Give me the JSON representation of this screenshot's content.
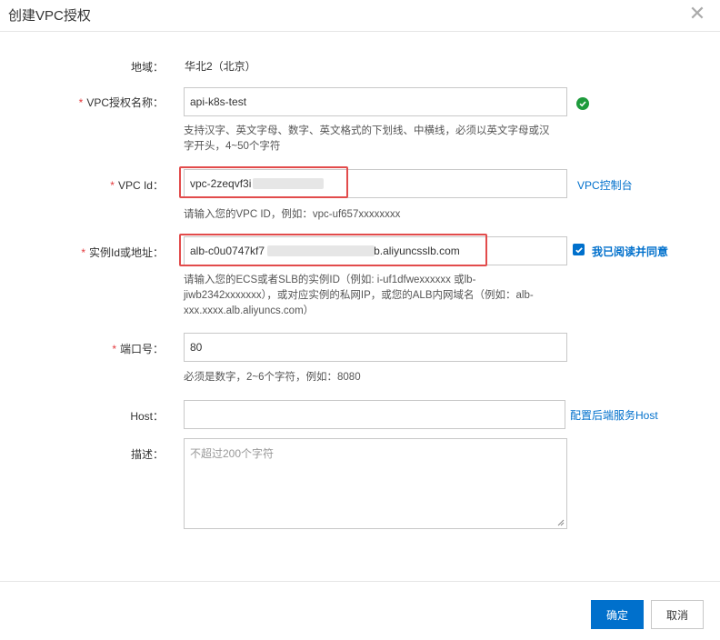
{
  "dialog": {
    "title": "创建VPC授权",
    "close_glyph": "✕"
  },
  "form": {
    "region": {
      "label": "地域：",
      "value": "华北2（北京）"
    },
    "auth_name": {
      "required_mark": "*",
      "label": "VPC授权名称：",
      "value": "api-k8s-test",
      "hint_line1": "支持汉字、英文字母、数字、英文格式的下划线、中横线，必须以英文字母或汉",
      "hint_line2": "字开头，4~50个字符"
    },
    "vpc_id": {
      "required_mark": "*",
      "label": "VPC Id：",
      "value": "vpc-2zeqvf3i",
      "link": "VPC控制台",
      "hint": "请输入您的VPC ID，例如：vpc-uf657xxxxxxxx"
    },
    "instance": {
      "required_mark": "*",
      "label": "实例Id或地址：",
      "value_prefix": "alb-c0u0747kf7",
      "value_suffix": "b.aliyuncsslb.com",
      "agree_label": "我已阅读并同意",
      "hint_line1": "请输入您的ECS或者SLB的实例ID（例如: i-uf1dfwexxxxxx 或lb-",
      "hint_line2": "jiwb2342xxxxxxx），或对应实例的私网IP，或您的ALB内网域名（例如：alb-",
      "hint_line3": "xxx.xxxx.alb.aliyuncs.com）"
    },
    "port": {
      "required_mark": "*",
      "label": "端口号：",
      "value": "80",
      "hint": "必须是数字，2~6个字符，例如：8080"
    },
    "host": {
      "label": "Host：",
      "value": "",
      "link": "配置后端服务Host"
    },
    "description": {
      "label": "描述：",
      "placeholder": "不超过200个字符"
    }
  },
  "footer": {
    "confirm_label": "确定",
    "cancel_label": "取消"
  },
  "colors": {
    "primary": "#0070cc",
    "highlight_border": "#e24b4b",
    "success": "#1e9b3c",
    "required": "#e4393c"
  }
}
